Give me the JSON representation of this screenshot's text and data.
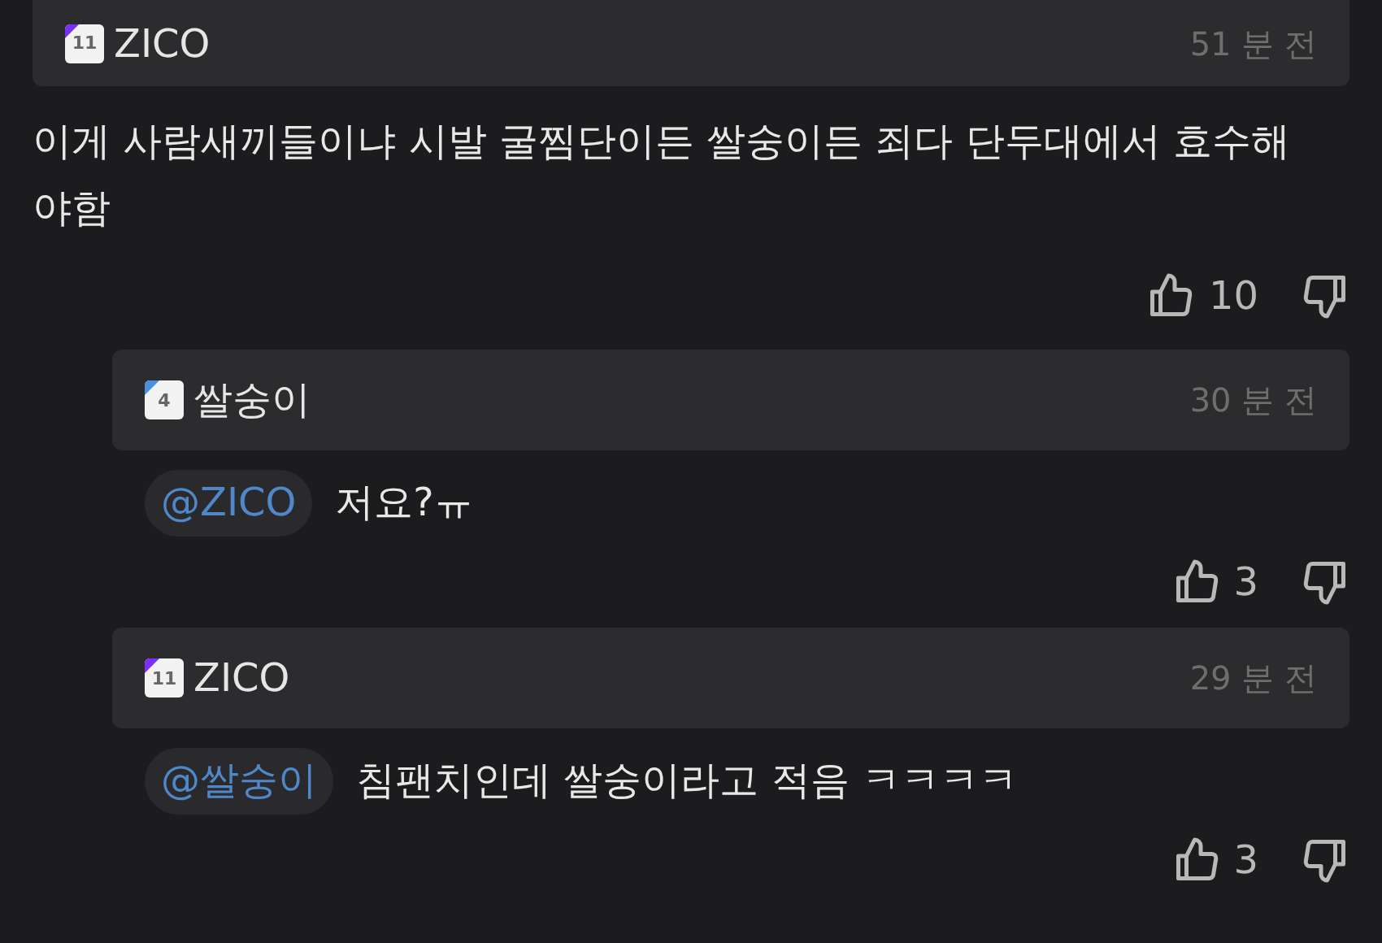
{
  "comments": [
    {
      "author": "ZICO",
      "badge": {
        "text": "11",
        "color": "#7b2ff7"
      },
      "time": "51 분 전",
      "text": "이게 사람새끼들이냐 시발 굴찜단이든 쌀숭이든 죄다 단두대에서 효수해야함",
      "likes": "10",
      "reply": false
    },
    {
      "author": "쌀숭이",
      "badge": {
        "text": "4",
        "color": "#4a90e2"
      },
      "time": "30 분 전",
      "mention": "@ZICO",
      "text": "저요?ㅠ",
      "likes": "3",
      "reply": true
    },
    {
      "author": "ZICO",
      "badge": {
        "text": "11",
        "color": "#7b2ff7"
      },
      "time": "29 분 전",
      "mention": "@쌀숭이",
      "text": "침팬치인데 쌀숭이라고 적음 ㅋㅋㅋㅋ",
      "likes": "3",
      "reply": true
    }
  ]
}
